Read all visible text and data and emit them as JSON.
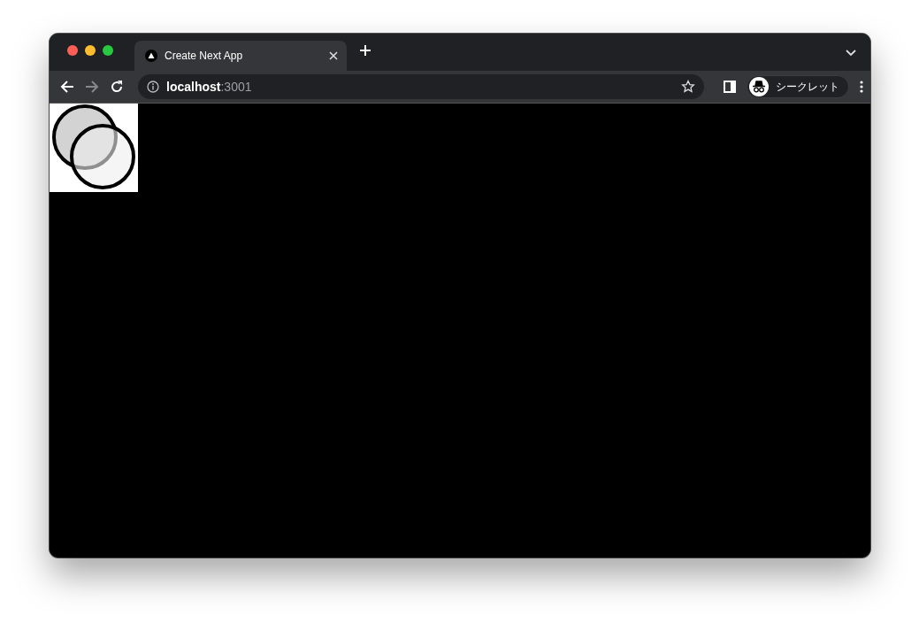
{
  "tabs": [
    {
      "title": "Create Next App",
      "selected": true
    }
  ],
  "address": {
    "host": "localhost",
    "port": ":3001"
  },
  "profile": {
    "label": "シークレット"
  }
}
